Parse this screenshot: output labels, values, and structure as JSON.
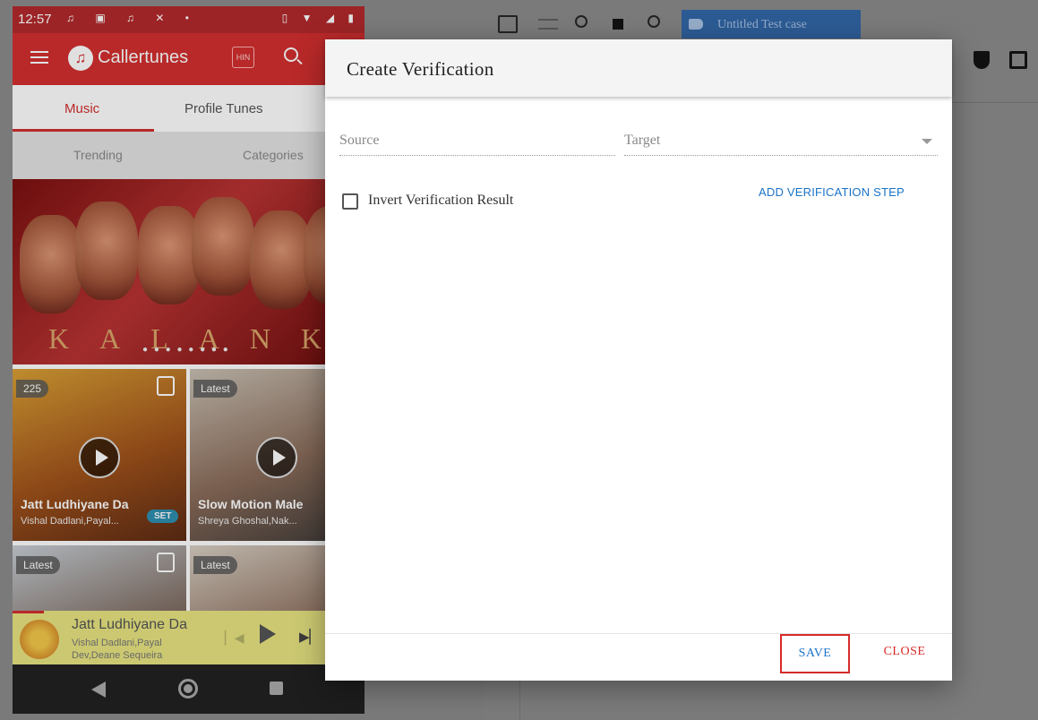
{
  "phone": {
    "status_bar": {
      "time": "12:57"
    },
    "app_bar": {
      "app_name": "Callertunes",
      "language_chip": "HIN"
    },
    "main_tabs": [
      "Music",
      "Profile Tunes"
    ],
    "sub_tabs": [
      "Trending",
      "Categories"
    ],
    "banner": {
      "title": "KALANK"
    },
    "cards": [
      {
        "badge": "225",
        "title": "Jatt Ludhiyane Da",
        "subtitle": "Vishal Dadlani,Payal...",
        "action": "SET"
      },
      {
        "badge": "Latest",
        "title": "Slow Motion Male",
        "subtitle": "Shreya Ghoshal,Nak..."
      },
      {
        "badge": "Latest"
      },
      {
        "badge": "Latest"
      }
    ],
    "mini_player": {
      "title": "Jatt Ludhiyane Da",
      "subtitle": "Vishal Dadlani,Payal\nDev,Deane Sequeira"
    }
  },
  "editor": {
    "test_case_title": "Untitled Test case"
  },
  "dialog": {
    "title": "Create Verification",
    "source_label": "Source",
    "target_label": "Target",
    "invert_label": "Invert Verification Result",
    "invert_checked": false,
    "add_step_label": "ADD VERIFICATION STEP",
    "save_label": "SAVE",
    "close_label": "CLOSE"
  }
}
